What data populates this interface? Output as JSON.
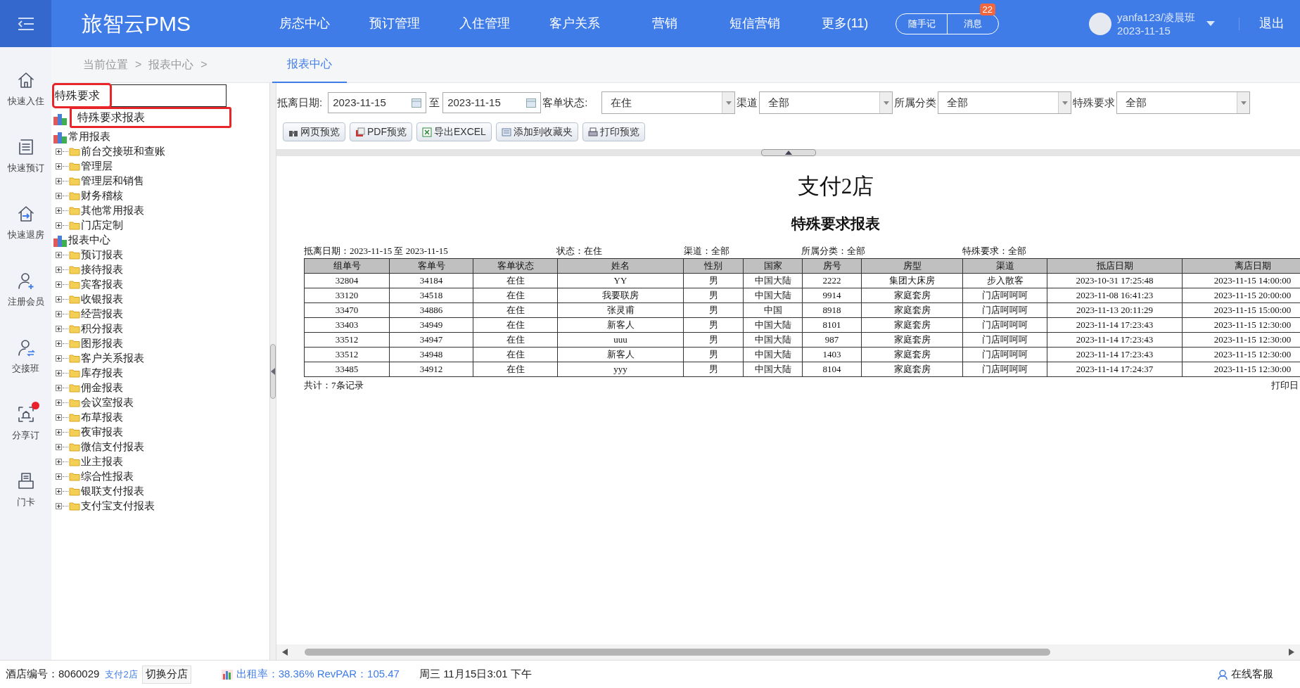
{
  "app": {
    "logo": "旅智云PMS"
  },
  "nav": [
    {
      "label": "房态中心"
    },
    {
      "label": "预订管理"
    },
    {
      "label": "入住管理"
    },
    {
      "label": "客户关系"
    },
    {
      "label": "营销"
    },
    {
      "label": "短信营销"
    },
    {
      "label": "更多(11)"
    }
  ],
  "quick_buttons": [
    {
      "label": "随手记"
    },
    {
      "label": "消息",
      "badge": "22"
    }
  ],
  "user": {
    "name": "yanfa123/凌晨班",
    "date": "2023-11-15",
    "logout": "退出"
  },
  "sidebar": [
    {
      "label": "快速入住",
      "kind": "checkin",
      "dot": false
    },
    {
      "label": "快速预订",
      "kind": "booking",
      "dot": false
    },
    {
      "label": "快速退房",
      "kind": "checkout",
      "dot": false
    },
    {
      "label": "注册会员",
      "kind": "member",
      "dot": false
    },
    {
      "label": "交接班",
      "kind": "shift",
      "dot": false
    },
    {
      "label": "分享订",
      "kind": "share",
      "dot": true
    },
    {
      "label": "门卡",
      "kind": "card",
      "dot": false
    }
  ],
  "breadcrumb": [
    "当前位置",
    ">",
    "报表中心",
    ">"
  ],
  "tabs": [
    {
      "label": "报表中心",
      "selected": true
    }
  ],
  "tree_search": {
    "value": "特殊要求",
    "highlighted": true,
    "suggestion": {
      "label": "特殊要求报表",
      "highlighted": true
    }
  },
  "tree": [
    {
      "label": "常用报表",
      "children": [
        {
          "label": "前台交接班和查账"
        },
        {
          "label": "管理层"
        },
        {
          "label": "管理层和销售"
        },
        {
          "label": "财务稽核"
        },
        {
          "label": "其他常用报表"
        },
        {
          "label": "门店定制"
        }
      ]
    },
    {
      "label": "报表中心",
      "children": [
        {
          "label": "预订报表"
        },
        {
          "label": "接待报表"
        },
        {
          "label": "宾客报表"
        },
        {
          "label": "收银报表"
        },
        {
          "label": "经营报表"
        },
        {
          "label": "积分报表"
        },
        {
          "label": "图形报表"
        },
        {
          "label": "客户关系报表"
        },
        {
          "label": "库存报表"
        },
        {
          "label": "佣金报表"
        },
        {
          "label": "会议室报表"
        },
        {
          "label": "布草报表"
        },
        {
          "label": "夜审报表"
        },
        {
          "label": "微信支付报表"
        },
        {
          "label": "业主报表"
        },
        {
          "label": "综合性报表"
        },
        {
          "label": "银联支付报表"
        },
        {
          "label": "支付宝支付报表"
        }
      ]
    }
  ],
  "filters": {
    "date_label": "抵离日期:",
    "date_from": "2023-11-15",
    "to": "至",
    "date_to": "2023-11-15",
    "selects": [
      {
        "label": "客单状态:",
        "value": "在住"
      },
      {
        "label": "渠道",
        "value": "全部"
      },
      {
        "label": "所属分类",
        "value": "全部"
      },
      {
        "label": "特殊要求",
        "value": "全部"
      }
    ]
  },
  "actions": [
    {
      "label": "网页预览",
      "kind": "web"
    },
    {
      "label": "PDF预览",
      "kind": "pdf"
    },
    {
      "label": "导出EXCEL",
      "kind": "excel"
    },
    {
      "label": "添加到收藏夹",
      "kind": "fav"
    },
    {
      "label": "打印预览",
      "kind": "print"
    }
  ],
  "report": {
    "hotel": "支付2店",
    "title": "特殊要求报表",
    "criteria": [
      "抵离日期：2023-11-15 至 2023-11-15",
      "状态：在住",
      "渠道：全部",
      "所属分类：全部",
      "特殊要求：全部"
    ],
    "columns": [
      "组单号",
      "客单号",
      "客单状态",
      "姓名",
      "性别",
      "国家",
      "房号",
      "房型",
      "渠道",
      "抵店日期",
      "离店日期"
    ],
    "rows": [
      [
        "32804",
        "34184",
        "在住",
        "YY",
        "男",
        "中国大陆",
        "2222",
        "集团大床房",
        "步入散客",
        "2023-10-31 17:25:48",
        "2023-11-15 14:00:00"
      ],
      [
        "33120",
        "34518",
        "在住",
        "我要联房",
        "男",
        "中国大陆",
        "9914",
        "家庭套房",
        "门店呵呵呵",
        "2023-11-08 16:41:23",
        "2023-11-15 20:00:00"
      ],
      [
        "33470",
        "34886",
        "在住",
        "张灵甫",
        "男",
        "中国",
        "8918",
        "家庭套房",
        "门店呵呵呵",
        "2023-11-13 20:11:29",
        "2023-11-15 15:00:00"
      ],
      [
        "33403",
        "34949",
        "在住",
        "新客人",
        "男",
        "中国大陆",
        "8101",
        "家庭套房",
        "门店呵呵呵",
        "2023-11-14 17:23:43",
        "2023-11-15 12:30:00"
      ],
      [
        "33512",
        "34947",
        "在住",
        "uuu",
        "男",
        "中国大陆",
        "987",
        "家庭套房",
        "门店呵呵呵",
        "2023-11-14 17:23:43",
        "2023-11-15 12:30:00"
      ],
      [
        "33512",
        "34948",
        "在住",
        "新客人",
        "男",
        "中国大陆",
        "1403",
        "家庭套房",
        "门店呵呵呵",
        "2023-11-14 17:23:43",
        "2023-11-15 12:30:00"
      ],
      [
        "33485",
        "34912",
        "在住",
        "yyy",
        "男",
        "中国大陆",
        "8104",
        "家庭套房",
        "门店呵呵呵",
        "2023-11-14 17:24:37",
        "2023-11-15 12:30:00"
      ]
    ],
    "total": "共计：7条记录",
    "print_date": "打印日"
  },
  "status_bar": {
    "hotel_label": "酒店编号：",
    "hotel_id": "8060029",
    "store": "支付2店",
    "switch": "切换分店",
    "occupancy": "出租率：38.36% RevPAR：105.47",
    "time": "周三 11月15日3:01 下午",
    "service": "在线客服"
  }
}
